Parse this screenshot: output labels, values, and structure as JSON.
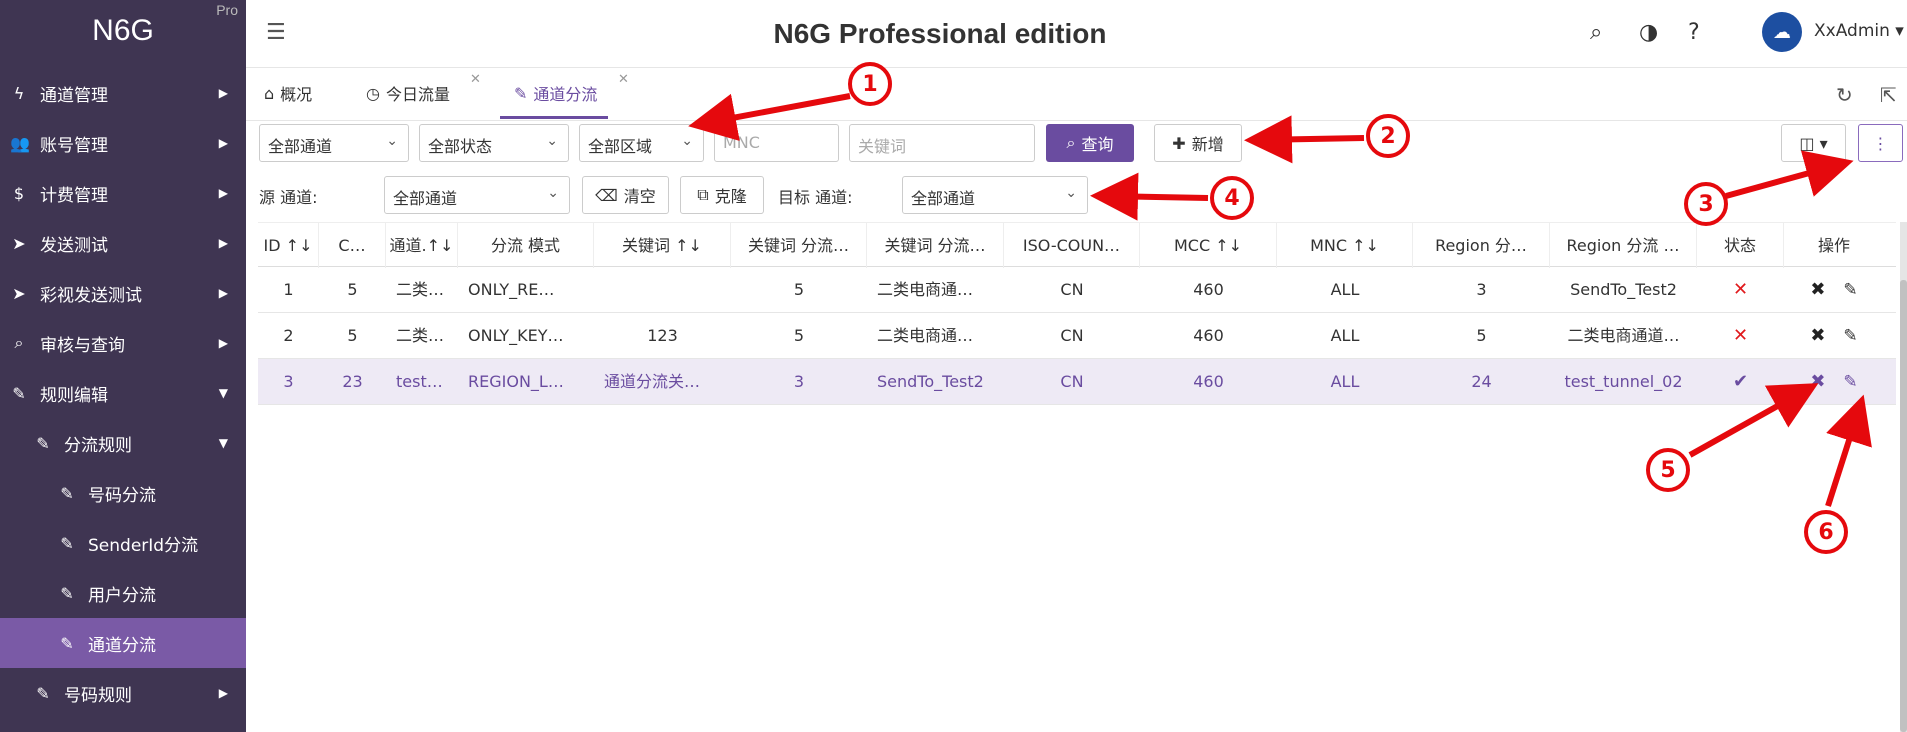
{
  "app": {
    "logo": "N6G",
    "edition_badge": "Pro",
    "title": "N6G Professional edition"
  },
  "user": {
    "name": "XxAdmin"
  },
  "sidebar": {
    "items": [
      {
        "label": "通道管理",
        "icon": "bolt-icon"
      },
      {
        "label": "账号管理",
        "icon": "users-icon"
      },
      {
        "label": "计费管理",
        "icon": "dollar-icon"
      },
      {
        "label": "发送测试",
        "icon": "send-icon"
      },
      {
        "label": "彩视发送测试",
        "icon": "send-icon"
      },
      {
        "label": "审核与查询",
        "icon": "search-icon"
      },
      {
        "label": "规则编辑",
        "icon": "edit-icon"
      },
      {
        "label": "分流规则",
        "icon": "edit-icon"
      },
      {
        "label": "号码分流",
        "icon": "edit-icon"
      },
      {
        "label": "SenderId分流",
        "icon": "edit-icon"
      },
      {
        "label": "用户分流",
        "icon": "edit-icon"
      },
      {
        "label": "通道分流",
        "icon": "edit-icon"
      },
      {
        "label": "号码规则",
        "icon": "edit-icon"
      }
    ]
  },
  "tabs": [
    {
      "label": "概况"
    },
    {
      "label": "今日流量"
    },
    {
      "label": "通道分流"
    }
  ],
  "filters": {
    "channel": "全部通道",
    "status": "全部状态",
    "region": "全部区域",
    "mnc_placeholder": "MNC",
    "keyword_placeholder": "关键词",
    "query_button": "查询",
    "add_button": "新增"
  },
  "filters2": {
    "source_label": "源 通道:",
    "source_value": "全部通道",
    "clear_button": "清空",
    "clone_button": "克隆",
    "target_label": "目标 通道:",
    "target_value": "全部通道"
  },
  "table": {
    "headers": [
      "ID ↑↓",
      "C…",
      "通道.↑↓",
      "分流 模式",
      "关键词 ↑↓",
      "关键词 分流…",
      "关键词 分流…",
      "ISO-COUN…",
      "MCC ↑↓",
      "MNC ↑↓",
      "Region 分…",
      "Region 分流 …",
      "状态",
      "操作"
    ],
    "rows": [
      {
        "id": "1",
        "c": "5",
        "channel": "二类…",
        "mode": "ONLY_RE…",
        "keyword": "",
        "kw_split": "5",
        "kw_split2": "二类电商通…",
        "iso": "CN",
        "mcc": "460",
        "mnc": "ALL",
        "region": "3",
        "region2": "SendTo_Test2",
        "status": "fail"
      },
      {
        "id": "2",
        "c": "5",
        "channel": "二类…",
        "mode": "ONLY_KEY…",
        "keyword": "123",
        "kw_split": "5",
        "kw_split2": "二类电商通…",
        "iso": "CN",
        "mcc": "460",
        "mnc": "ALL",
        "region": "5",
        "region2": "二类电商通道…",
        "status": "fail"
      },
      {
        "id": "3",
        "c": "23",
        "channel": "test…",
        "mode": "REGION_L…",
        "keyword": "通道分流关…",
        "kw_split": "3",
        "kw_split2": "SendTo_Test2",
        "iso": "CN",
        "mcc": "460",
        "mnc": "ALL",
        "region": "24",
        "region2": "test_tunnel_02",
        "status": "ok"
      }
    ]
  },
  "annotations": [
    "1",
    "2",
    "3",
    "4",
    "5",
    "6"
  ],
  "colors": {
    "sidebar_bg": "#3f3552",
    "accent": "#6a4ca0",
    "annotation": "#e5090d"
  }
}
